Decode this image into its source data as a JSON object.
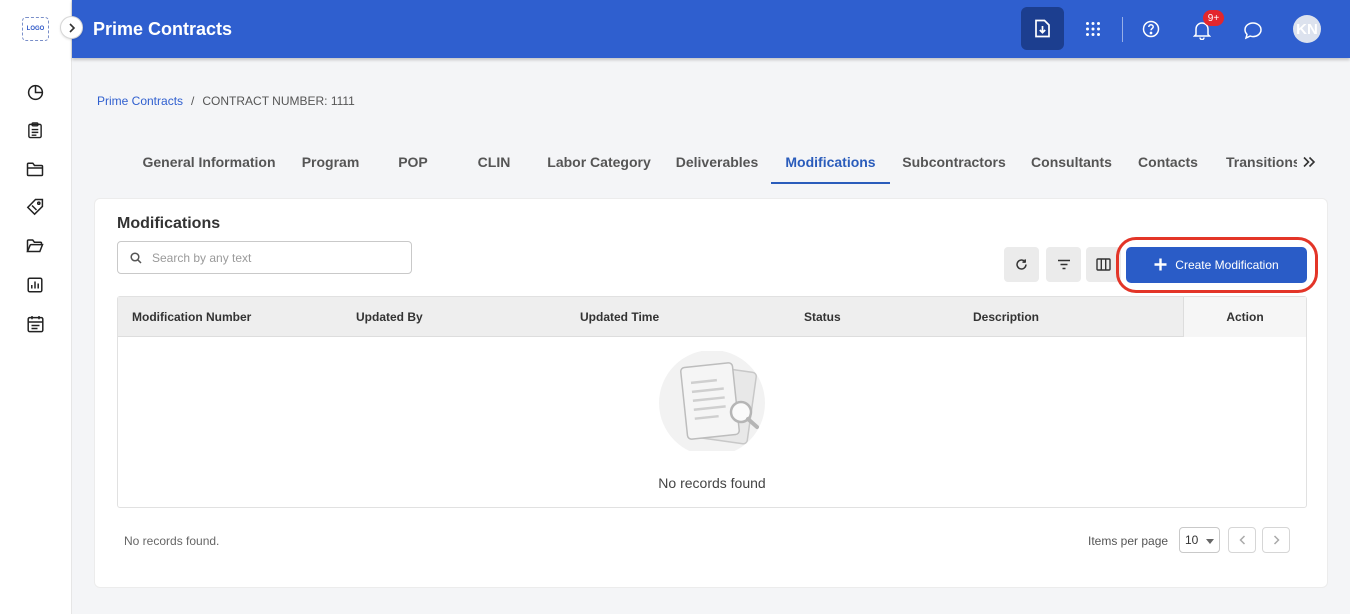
{
  "sidebar": {
    "logo_text": "LOGO",
    "icons": [
      "dashboard-pie-icon",
      "clipboard-icon",
      "folder-icon",
      "tag-icon",
      "folder-open-icon",
      "report-chart-icon",
      "calendar-icon"
    ]
  },
  "header": {
    "title": "Prime Contracts",
    "notification_count": "9+",
    "avatar_initials": "KN",
    "brand_color": "#2f5fcf"
  },
  "breadcrumb": {
    "root": "Prime Contracts",
    "separator": "/",
    "current": "CONTRACT NUMBER: 1111"
  },
  "tabs": [
    {
      "label": "General Information"
    },
    {
      "label": "Program"
    },
    {
      "label": "POP"
    },
    {
      "label": "CLIN"
    },
    {
      "label": "Labor Category"
    },
    {
      "label": "Deliverables"
    },
    {
      "label": "Modifications",
      "active": true
    },
    {
      "label": "Subcontractors"
    },
    {
      "label": "Consultants"
    },
    {
      "label": "Contacts"
    },
    {
      "label": "Transitions"
    }
  ],
  "panel": {
    "title": "Modifications",
    "search_placeholder": "Search by any text",
    "create_button_label": "Create Modification",
    "columns": [
      "Modification Number",
      "Updated By",
      "Updated Time",
      "Status",
      "Description",
      "Action"
    ],
    "empty_message": "No records found",
    "footer_count": "No records found.",
    "items_per_page_label": "Items per page",
    "items_per_page_value": "10"
  }
}
